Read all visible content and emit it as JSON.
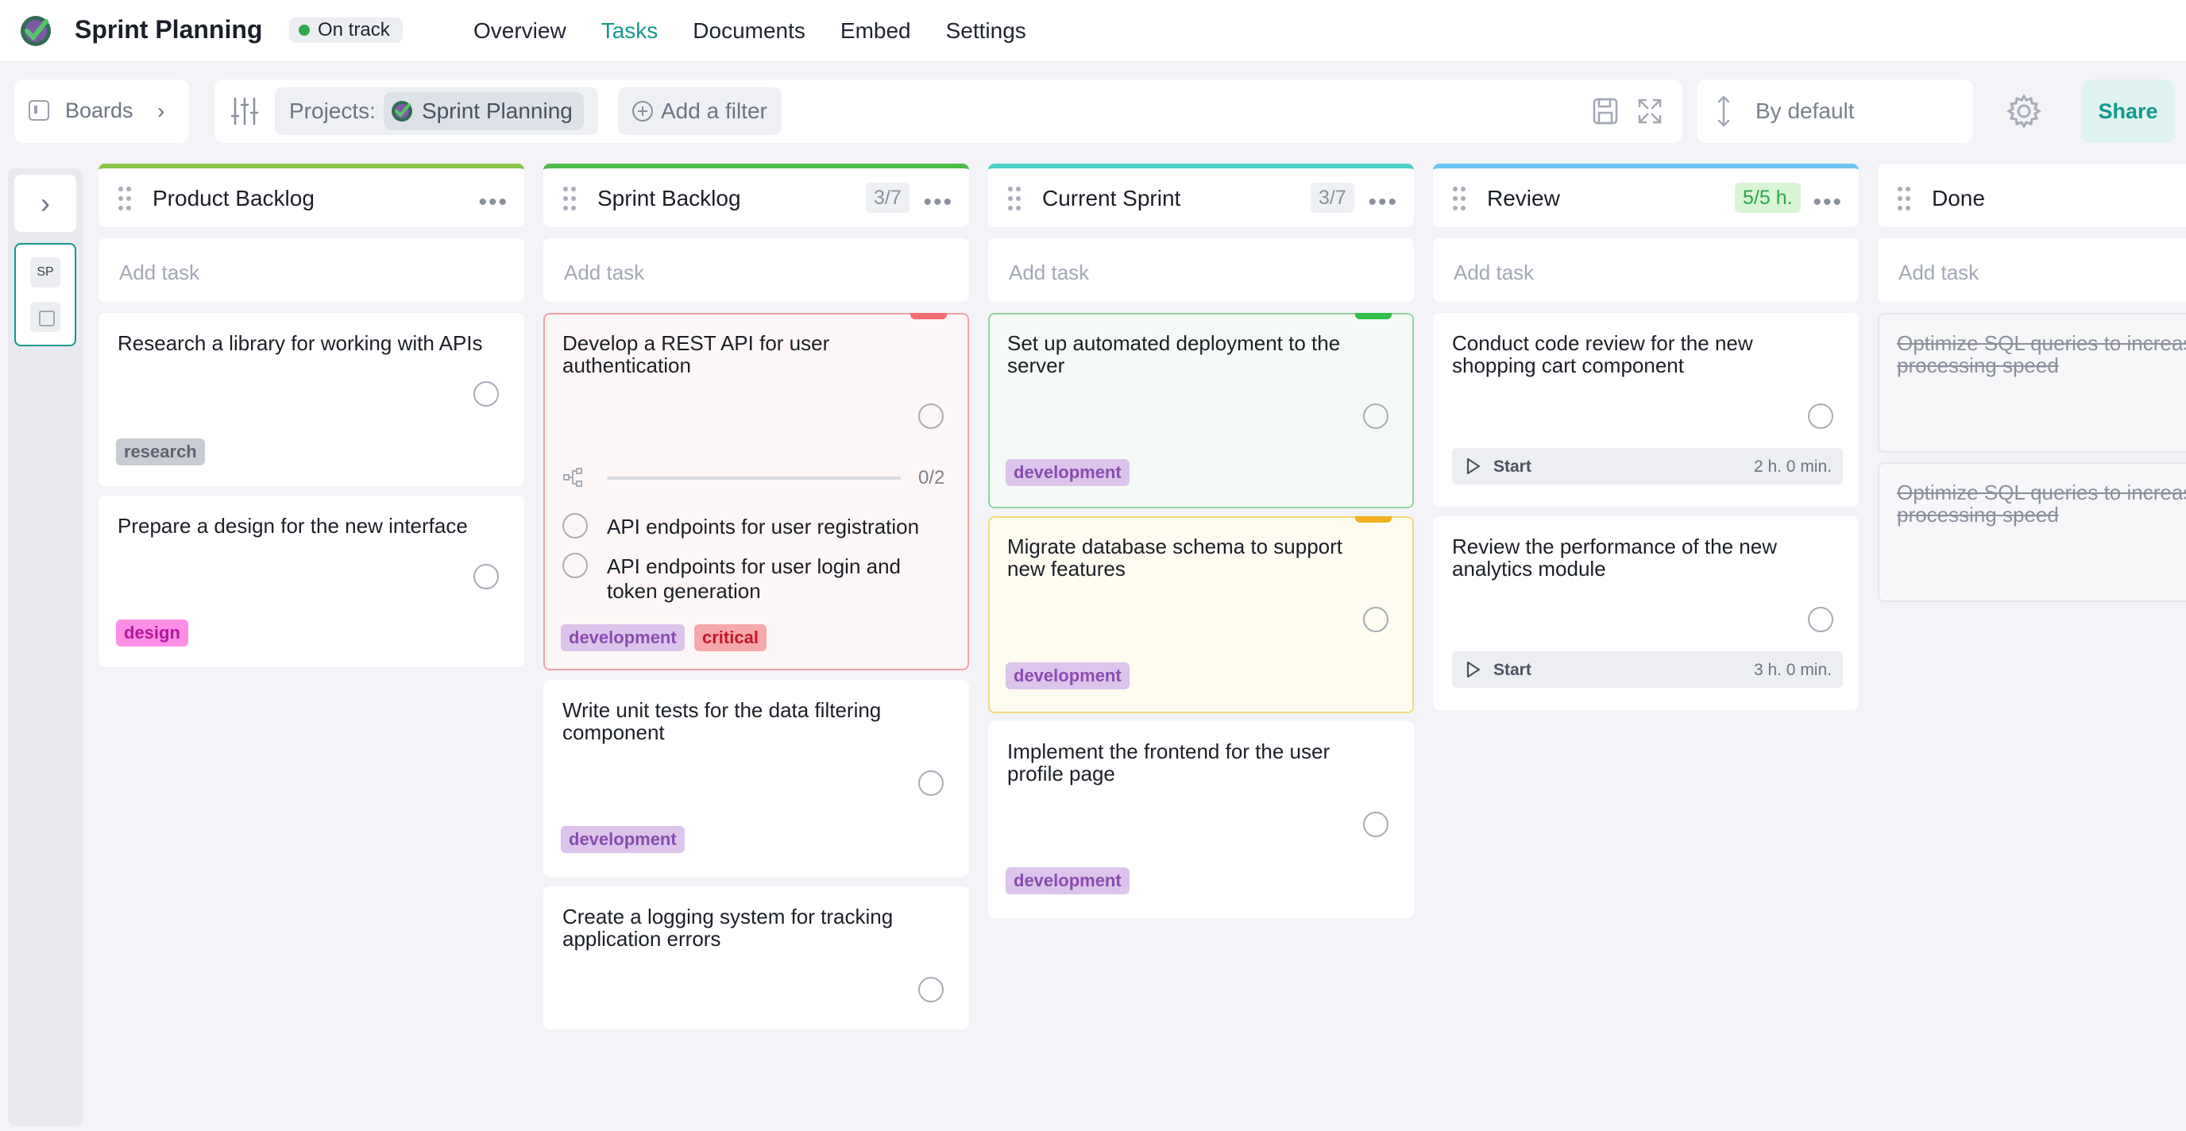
{
  "app": {
    "title": "Sprint Planning",
    "status": "On track",
    "status_color": "#2fa84f",
    "accent_color": "#12988e"
  },
  "nav": {
    "items": [
      "Overview",
      "Tasks",
      "Documents",
      "Embed",
      "Settings"
    ],
    "active": "Tasks"
  },
  "toolbar": {
    "boards_label": "Boards",
    "projects_label": "Projects:",
    "project_name": "Sprint Planning",
    "add_filter_label": "Add a filter",
    "sort_label": "By default",
    "share_label": "Share"
  },
  "side_rail": {
    "badge_label": "SP"
  },
  "columns": [
    {
      "title": "Product Backlog",
      "count": "",
      "color": "#8bc34a",
      "add_task": "Add task",
      "cards": [
        {
          "title": "Research a library for working with APIs",
          "tags": [
            "research"
          ]
        },
        {
          "title": "Prepare a design for the new interface",
          "tags": [
            "design"
          ]
        }
      ]
    },
    {
      "title": "Sprint Backlog",
      "count": "3/7",
      "color": "#4cbb4c",
      "add_task": "Add task",
      "cards": [
        {
          "title": "Develop a REST API for user authentication",
          "priority_color": "#f26d74",
          "subtask_progress": "0/2",
          "subtask_fraction": 0,
          "subtasks": [
            "API endpoints for user registration",
            "API endpoints for user login and token generation"
          ],
          "tags": [
            "development",
            "critical"
          ]
        },
        {
          "title": "Write unit tests for the data filtering component",
          "tags": [
            "development"
          ]
        },
        {
          "title": "Create a logging system for tracking application errors",
          "tags": []
        }
      ]
    },
    {
      "title": "Current Sprint",
      "count": "3/7",
      "color": "#4dd0c8",
      "add_task": "Add task",
      "cards": [
        {
          "title": "Set up automated deployment to the server",
          "priority_color": "#2fbf4a",
          "tags": [
            "development"
          ]
        },
        {
          "title": "Migrate database schema to support new features",
          "priority_color": "#f2b01e",
          "tags": [
            "development"
          ]
        },
        {
          "title": "Implement the frontend for the user profile page",
          "tags": [
            "development"
          ]
        }
      ]
    },
    {
      "title": "Review",
      "count": "5/5 h.",
      "color": "#6ec6f0",
      "add_task": "Add task",
      "cards": [
        {
          "title": "Conduct code review for the new shopping cart component",
          "timer_label": "Start",
          "timer_time": "2 h. 0 min."
        },
        {
          "title": "Review the performance of the new analytics module",
          "timer_label": "Start",
          "timer_time": "3 h. 0 min."
        }
      ]
    },
    {
      "title": "Done",
      "count": "",
      "color": "#ffffff",
      "add_task": "Add task",
      "cards": [
        {
          "title": "Optimize SQL queries to increase processing speed"
        },
        {
          "title": "Optimize SQL queries to increase processing speed"
        }
      ]
    }
  ]
}
